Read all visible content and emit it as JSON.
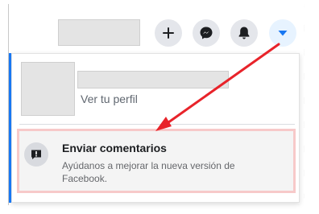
{
  "header": {
    "buttons": [
      {
        "name": "create-button",
        "icon": "plus-icon"
      },
      {
        "name": "messenger-button",
        "icon": "messenger-icon"
      },
      {
        "name": "notifications-button",
        "icon": "bell-icon"
      },
      {
        "name": "account-button",
        "icon": "caret-down-icon"
      }
    ]
  },
  "menu": {
    "profile_link": "Ver tu perfil",
    "feedback": {
      "title": "Enviar comentarios",
      "description": "Ayúdanos a mejorar la nueva versión de Facebook."
    }
  },
  "colors": {
    "accent": "#1877f2",
    "arrow": "#e8232a",
    "highlight_border": "#f7c9c9"
  }
}
